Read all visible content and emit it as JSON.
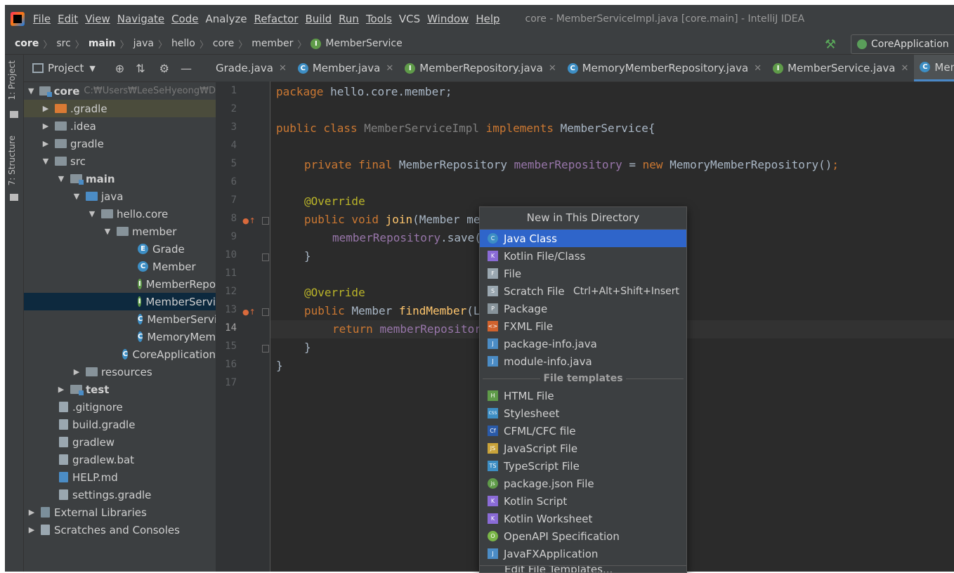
{
  "menubar": {
    "items": [
      "File",
      "Edit",
      "View",
      "Navigate",
      "Code",
      "Analyze",
      "Refactor",
      "Build",
      "Run",
      "Tools",
      "VCS",
      "Window",
      "Help"
    ],
    "window_title": "core - MemberServiceImpl.java [core.main] - IntelliJ IDEA"
  },
  "breadcrumbs": [
    "core",
    "src",
    "main",
    "java",
    "hello",
    "core",
    "member",
    "MemberService"
  ],
  "run_config": "CoreApplication",
  "sidebar_tabs": {
    "project": "1: Project",
    "structure": "7: Structure"
  },
  "project_panel": {
    "title": "Project",
    "root": {
      "label": "core",
      "path": "C:₩Users₩LeeSeHyeong₩D"
    },
    "rows": [
      {
        "label": ".gradle"
      },
      {
        "label": ".idea"
      },
      {
        "label": "gradle"
      },
      {
        "label": "src"
      },
      {
        "label": "main"
      },
      {
        "label": "java"
      },
      {
        "label": "hello.core"
      },
      {
        "label": "member"
      },
      {
        "label": "Grade"
      },
      {
        "label": "Member"
      },
      {
        "label": "MemberRepo"
      },
      {
        "label": "MemberServi"
      },
      {
        "label": "MemberServi"
      },
      {
        "label": "MemoryMem"
      },
      {
        "label": "CoreApplication"
      },
      {
        "label": "resources"
      },
      {
        "label": "test"
      },
      {
        "label": ".gitignore"
      },
      {
        "label": "build.gradle"
      },
      {
        "label": "gradlew"
      },
      {
        "label": "gradlew.bat"
      },
      {
        "label": "HELP.md"
      },
      {
        "label": "settings.gradle"
      },
      {
        "label": "External Libraries"
      },
      {
        "label": "Scratches and Consoles"
      }
    ]
  },
  "tabs": [
    "Grade.java",
    "Member.java",
    "MemberRepository.java",
    "MemoryMemberRepository.java",
    "MemberService.java",
    "MemberSe"
  ],
  "code": {
    "line_numbers": [
      "1",
      "2",
      "3",
      "4",
      "5",
      "6",
      "7",
      "8",
      "9",
      "10",
      "11",
      "12",
      "13",
      "14",
      "15",
      "16",
      "17"
    ],
    "l1_kw": "package",
    "l1_rest": " hello.core.member;",
    "l3_kw": "public class ",
    "l3_name": "MemberServiceImpl ",
    "l3_kw2": "implements ",
    "l3_rest": "MemberService{",
    "l5_kw": "private final ",
    "l5_type": "MemberRepository ",
    "l5_field": "memberRepository",
    "l5_eq": " = ",
    "l5_kw2": "new ",
    "l5_rest": "MemoryMemberRepository()",
    "l5_semi": ";",
    "l7": "@Override",
    "l8_kw": "public void ",
    "l8_fn": "join",
    "l8_rest": "(Member me",
    "l9_field": "memberRepository",
    "l9_rest": ".save(",
    "l10": "}",
    "l12": "@Override",
    "l13_kw": "public ",
    "l13_type": "Member ",
    "l13_fn": "findMember",
    "l13_rest": "(L",
    "l14_kw": "return ",
    "l14_field": "memberRepositor",
    "l15": "}",
    "l16": "}"
  },
  "popup": {
    "title": "New in This Directory",
    "items": [
      {
        "label": "Java Class",
        "icon": "C",
        "color": "#3d8ec4"
      },
      {
        "label": "Kotlin File/Class",
        "icon": "K",
        "color": "#8a6bd6"
      },
      {
        "label": "File",
        "icon": "F",
        "color": "#9aa7b0"
      },
      {
        "label": "Scratch File",
        "icon": "S",
        "color": "#9aa7b0",
        "shortcut": "Ctrl+Alt+Shift+Insert"
      },
      {
        "label": "Package",
        "icon": "P",
        "color": "#87939a"
      },
      {
        "label": "FXML File",
        "icon": "<>",
        "color": "#d0622d"
      },
      {
        "label": "package-info.java",
        "icon": "J",
        "color": "#4b8cc5"
      },
      {
        "label": "module-info.java",
        "icon": "J",
        "color": "#4b8cc5"
      }
    ],
    "section": "File templates",
    "templates": [
      {
        "label": "HTML File",
        "icon": "H",
        "color": "#5f9b49"
      },
      {
        "label": "Stylesheet",
        "icon": "CSS",
        "color": "#3d8ec4"
      },
      {
        "label": "CFML/CFC file",
        "icon": "Cf",
        "color": "#2a5aa8"
      },
      {
        "label": "JavaScript File",
        "icon": "JS",
        "color": "#c9a33a"
      },
      {
        "label": "TypeScript File",
        "icon": "TS",
        "color": "#3d8ec4"
      },
      {
        "label": "package.json File",
        "icon": "js",
        "color": "#5f9b49"
      },
      {
        "label": "Kotlin Script",
        "icon": "K",
        "color": "#8a6bd6"
      },
      {
        "label": "Kotlin Worksheet",
        "icon": "K",
        "color": "#8a6bd6"
      },
      {
        "label": "OpenAPI Specification",
        "icon": "O",
        "color": "#7ab648"
      },
      {
        "label": "JavaFXApplication",
        "icon": "J",
        "color": "#4b8cc5"
      }
    ],
    "cut_item": "Edit File Templates..."
  }
}
